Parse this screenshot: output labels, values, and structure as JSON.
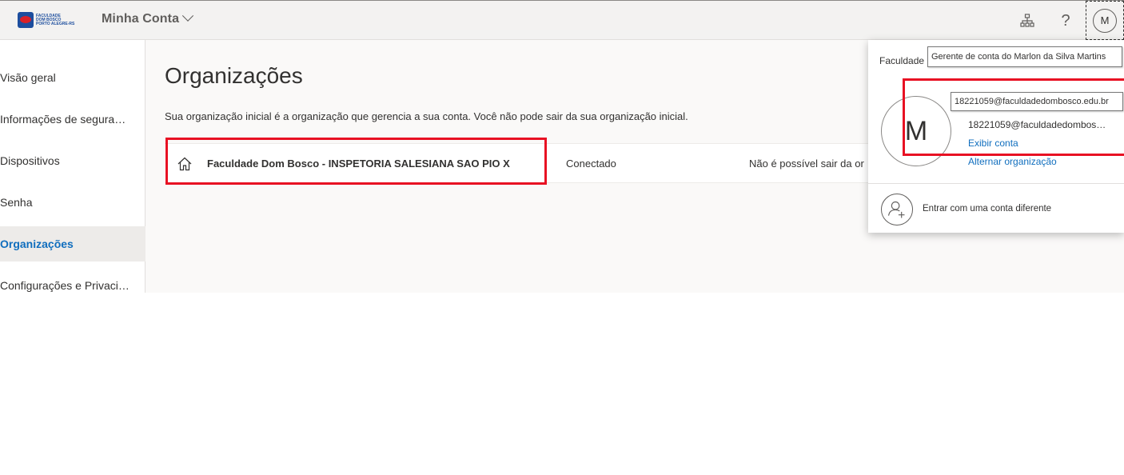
{
  "header": {
    "logo_lines": [
      "FACULDADE",
      "DOM BOSCO",
      "PORTO ALEGRE-RS"
    ],
    "app_title": "Minha Conta",
    "help_glyph": "?",
    "avatar_initial": "M",
    "icons": [
      "logo",
      "chevron-down-icon",
      "org-chart-icon",
      "help-icon"
    ]
  },
  "sidebar": {
    "items": [
      {
        "label": "Visão geral",
        "active": false
      },
      {
        "label": "Informações de segura…",
        "active": false
      },
      {
        "label": "Dispositivos",
        "active": false
      },
      {
        "label": "Senha",
        "active": false
      },
      {
        "label": "Organizações",
        "active": true
      },
      {
        "label": "Configurações e Privaci…",
        "active": false
      }
    ]
  },
  "main": {
    "title": "Organizações",
    "description": "Sua organização inicial é a organização que gerencia a sua conta. Você não pode sair da sua organização inicial.",
    "org": {
      "name": "Faculdade Dom Bosco - INSPETORIA SALESIANA SAO PIO X",
      "status": "Conectado",
      "note": "Não é possível sair da or"
    }
  },
  "flyout": {
    "org_label": "Faculdade",
    "tooltip": "Gerente de conta do Marlon da Silva Martins",
    "avatar_initial": "M",
    "email_tooltip": "18221059@faculdadedombosco.edu.br",
    "email": "18221059@faculdadedombos…",
    "view_account": "Exibir conta",
    "switch_org": "Alternar organização",
    "other_account": "Entrar com uma conta diferente"
  },
  "colors": {
    "accent": "#106ebe",
    "highlight_red": "#e81123",
    "header_bg": "#f3f2f1",
    "page_bg": "#faf9f8"
  }
}
